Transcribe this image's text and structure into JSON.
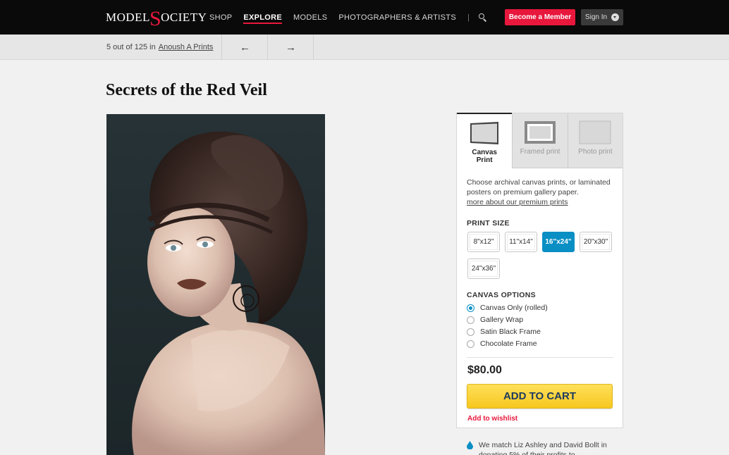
{
  "header": {
    "logo_left": "MODEL",
    "logo_s": "S",
    "logo_right": "OCIETY",
    "nav": [
      {
        "label": "SHOP"
      },
      {
        "label": "EXPLORE"
      },
      {
        "label": "MODELS"
      },
      {
        "label": "PHOTOGRAPHERS & ARTISTS"
      }
    ],
    "nav_separator": "|",
    "search_icon": "search-icon",
    "member_label": "Become a Member",
    "signin_label": "Sign In"
  },
  "subbar": {
    "position": "5 out of 125 in",
    "collection": "Anoush A Prints",
    "prev": "←",
    "next": "→"
  },
  "artwork": {
    "title": "Secrets of the Red Veil"
  },
  "purchase": {
    "tabs": [
      {
        "label": "Canvas Print",
        "icon": "canvas-icon"
      },
      {
        "label": "Framed print",
        "icon": "frame-icon"
      },
      {
        "label": "Photo print",
        "icon": "photo-icon"
      }
    ],
    "description": "Choose archival canvas prints, or laminated posters on premium gallery paper.",
    "more_link": "more about our premium prints",
    "print_size_label": "PRINT SIZE",
    "sizes": [
      "8\"x12\"",
      "11\"x14\"",
      "16\"x24\"",
      "20\"x30\"",
      "24\"x36\""
    ],
    "selected_size": "16\"x24\"",
    "canvas_options_label": "CANVAS OPTIONS",
    "options": [
      "Canvas Only (rolled)",
      "Gallery Wrap",
      "Satin Black Frame",
      "Chocolate Frame"
    ],
    "selected_option": "Canvas Only (rolled)",
    "price": "$80.00",
    "cart_label": "ADD TO CART",
    "wishlist_label": "Add to wishlist"
  },
  "donate": {
    "text": "We match Liz Ashley and David Bollt in donating 5% of their profits to"
  },
  "colors": {
    "accent": "#e8173c",
    "selected": "#0a8fc4",
    "cart": "#f6c71f"
  }
}
